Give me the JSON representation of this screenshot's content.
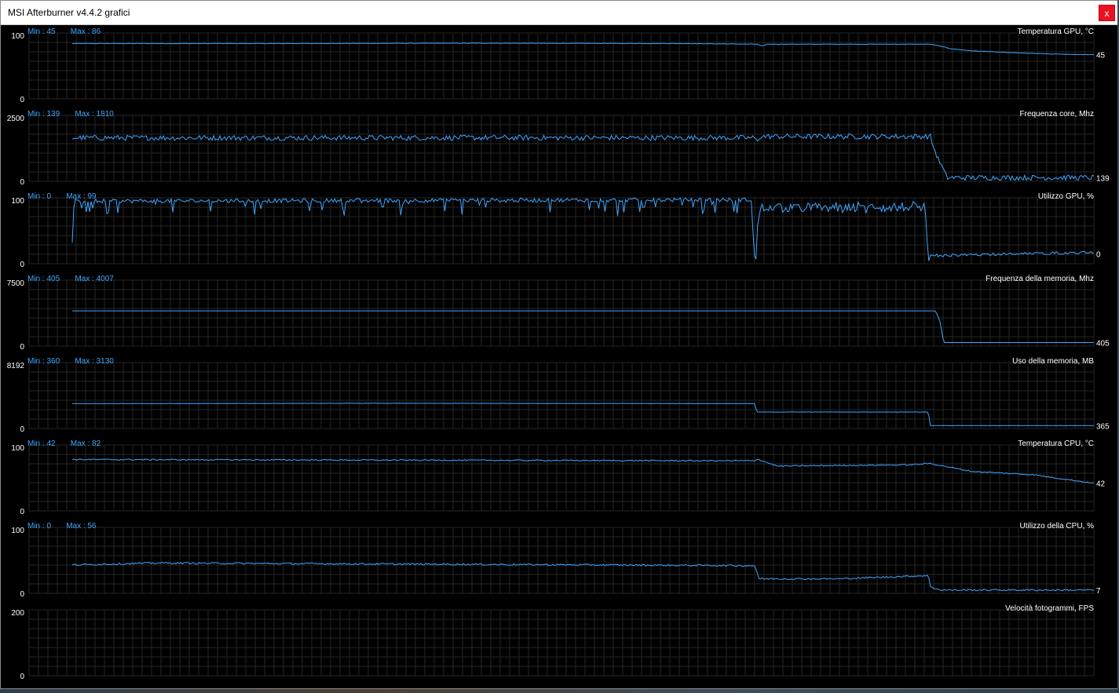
{
  "window": {
    "title": "MSI Afterburner v4.4.2 grafici",
    "close_label": "x"
  },
  "colors": {
    "line": "#3ea6ff",
    "grid": "#262626",
    "grid_minor": "#1a1a1a",
    "text": "#ffffff",
    "minmax": "#3ea6ff"
  },
  "graphs": [
    {
      "title": "Temperatura GPU, °C",
      "scale_max": "100",
      "scale_min": "0",
      "min": "Min : 45",
      "max": "Max : 86",
      "current": "45",
      "series": [
        [
          0,
          84
        ],
        [
          20,
          84
        ],
        [
          40,
          84.5
        ],
        [
          60,
          84
        ],
        [
          67,
          83
        ],
        [
          67.5,
          80
        ],
        [
          68,
          83
        ],
        [
          80,
          83
        ],
        [
          84,
          83
        ],
        [
          85,
          80
        ],
        [
          86,
          76
        ],
        [
          88,
          73
        ],
        [
          92,
          70
        ],
        [
          96,
          68
        ],
        [
          100,
          67
        ]
      ]
    },
    {
      "title": "Frequenza core, Mhz",
      "scale_max": "2500",
      "scale_min": "0",
      "min": "Min : 139",
      "max": "Max : 1810",
      "current": "139",
      "series": [
        [
          0,
          1650
        ],
        [
          66.8,
          1650
        ],
        [
          67,
          1500
        ],
        [
          67.3,
          1700
        ],
        [
          84,
          1700
        ],
        [
          84.3,
          1300
        ],
        [
          84.7,
          900
        ],
        [
          85.2,
          500
        ],
        [
          85.6,
          139
        ],
        [
          100,
          139
        ]
      ]
    },
    {
      "title": "Utilizzo GPU, %",
      "scale_max": "100",
      "scale_min": "0",
      "min": "Min : 0",
      "max": "Max : 99",
      "current": "0",
      "series": [
        [
          0,
          55
        ],
        [
          0.2,
          95
        ],
        [
          66.5,
          97
        ],
        [
          66.7,
          20
        ],
        [
          66.9,
          0
        ],
        [
          67.1,
          60
        ],
        [
          67.4,
          85
        ],
        [
          83.5,
          85
        ],
        [
          83.8,
          0
        ],
        [
          84,
          10
        ],
        [
          100,
          15
        ]
      ]
    },
    {
      "title": "Frequenza della memoria, Mhz",
      "scale_max": "7500",
      "scale_min": "0",
      "min": "Min : 405",
      "max": "Max : 4007",
      "current": "405",
      "series": [
        [
          0,
          4007
        ],
        [
          84.5,
          4007
        ],
        [
          84.9,
          3000
        ],
        [
          85.3,
          405
        ],
        [
          100,
          405
        ]
      ]
    },
    {
      "title": "Uso della memoria, MB",
      "scale_max": "8192",
      "scale_min": "0",
      "min": "Min : 360",
      "max": "Max : 3130",
      "current": "365",
      "series": [
        [
          0,
          3090
        ],
        [
          30,
          3130
        ],
        [
          66.8,
          3100
        ],
        [
          67,
          2050
        ],
        [
          83.8,
          2050
        ],
        [
          84,
          365
        ],
        [
          100,
          365
        ]
      ]
    },
    {
      "title": "Temperatura CPU, °C",
      "scale_max": "100",
      "scale_min": "0",
      "min": "Min : 42",
      "max": "Max : 82",
      "current": "42",
      "series": [
        [
          0,
          78
        ],
        [
          66.8,
          76
        ],
        [
          67,
          79
        ],
        [
          69,
          68
        ],
        [
          82,
          70
        ],
        [
          84,
          72
        ],
        [
          88,
          60
        ],
        [
          94,
          55
        ],
        [
          100,
          42
        ]
      ]
    },
    {
      "title": "Utilizzo della CPU, %",
      "scale_max": "100",
      "scale_min": "0",
      "min": "Min : 0",
      "max": "Max : 56",
      "current": "7",
      "series": [
        [
          0,
          43
        ],
        [
          8,
          46
        ],
        [
          66.8,
          42
        ],
        [
          67,
          34
        ],
        [
          67.2,
          22
        ],
        [
          75,
          22
        ],
        [
          83.8,
          27
        ],
        [
          84,
          10
        ],
        [
          85,
          5
        ],
        [
          100,
          5
        ]
      ]
    },
    {
      "title": "Velocità fotogrammi, FPS",
      "scale_max": "200",
      "scale_min": "0",
      "min": "",
      "max": "",
      "current": "",
      "series": []
    }
  ]
}
